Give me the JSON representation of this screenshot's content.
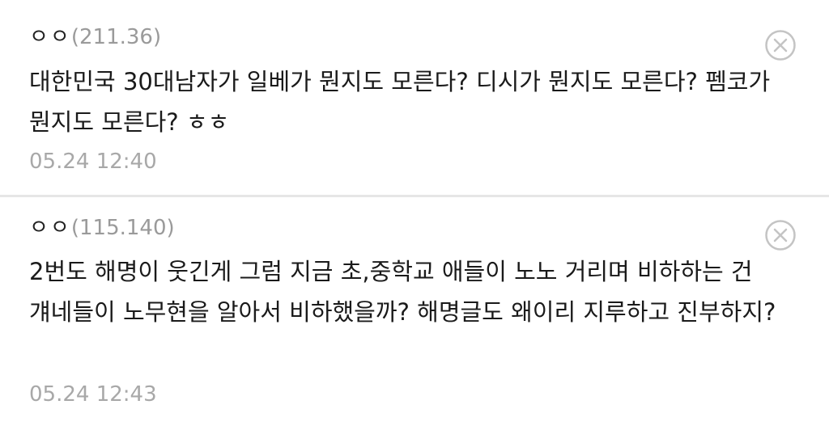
{
  "comments": [
    {
      "author": "ㅇㅇ",
      "ip": "(211.36)",
      "text": "대한민국 30대남자가 일베가 뭔지도 모른다? 디시가 뭔지도 모른다? 펨코가 뭔지도 모른다? ㅎㅎ",
      "timestamp": "05.24 12:40",
      "delete_icon": "close-circle-icon"
    },
    {
      "author": "ㅇㅇ",
      "ip": "(115.140)",
      "text": "2번도 해명이 웃긴게 그럼 지금 초,중학교 애들이 노노 거리며 비하하는 건 걔네들이 노무현을 알아서 비하했을까? 해명글도 왜이리 지루하고 진부하지?",
      "timestamp": "05.24 12:43",
      "delete_icon": "close-circle-icon"
    }
  ],
  "colors": {
    "author": "#222222",
    "ip": "#9a9a9a",
    "text": "#1a1a1a",
    "timestamp": "#a8a8a8",
    "divider": "#e6e6e6",
    "icon": "#c4c4c4"
  }
}
